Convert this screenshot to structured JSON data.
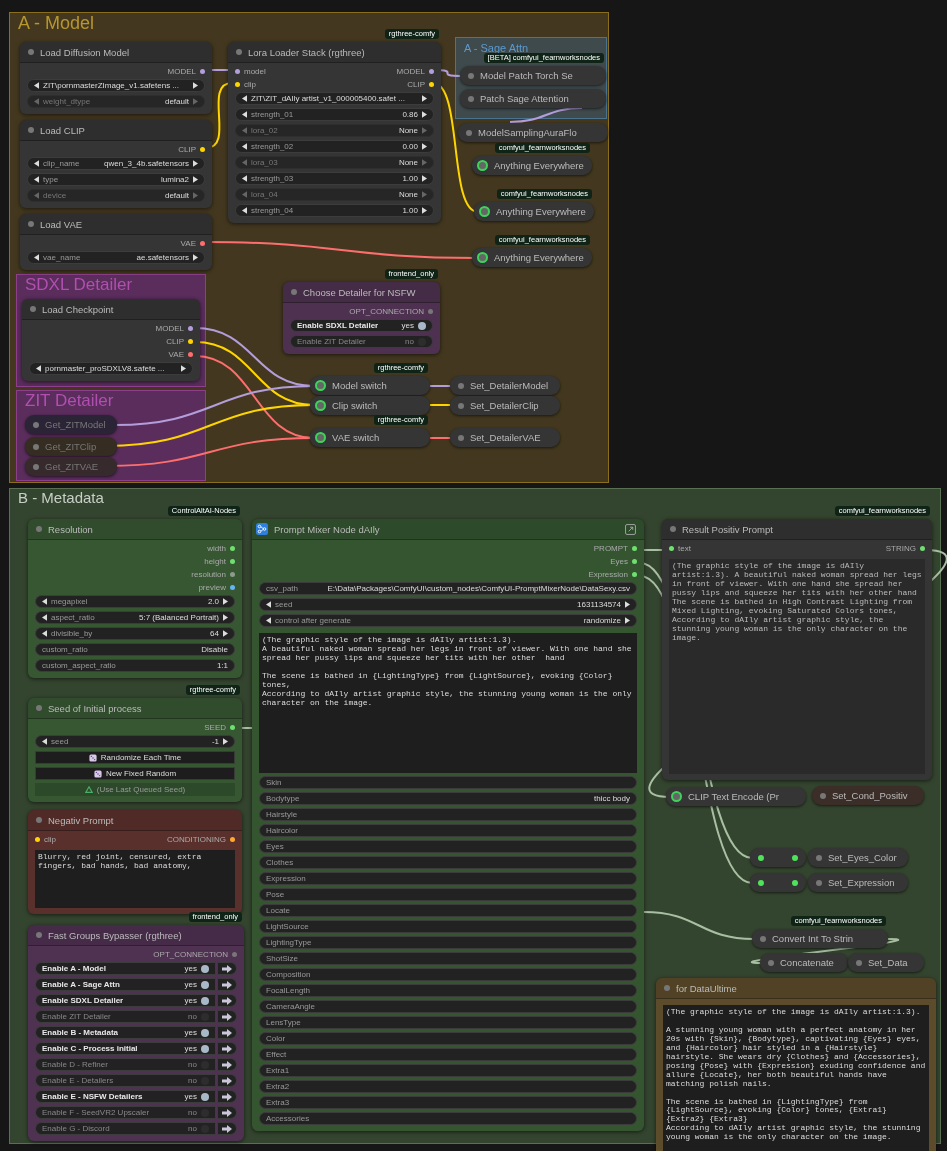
{
  "groups": [
    {
      "title": "A - Model"
    },
    {
      "title": "A - Sage Attn"
    },
    {
      "title": "SDXL Detailer"
    },
    {
      "title": "ZIT Detailer"
    },
    {
      "title": "B - Metadata"
    }
  ],
  "nodes": [
    {
      "kind": "node",
      "title": "Load Diffusion Model",
      "outputs": [
        {
          "label": "MODEL",
          "kind": "model"
        }
      ],
      "widgets": [
        {
          "kind": "combo",
          "value": "ZIT\\pornmasterZImage_v1.safetens ...",
          "disabled": false
        },
        {
          "kind": "combo",
          "label": "weight_dtype",
          "value": "default",
          "disabled": true
        }
      ]
    },
    {
      "kind": "node",
      "title": "Load CLIP",
      "outputs": [
        {
          "label": "CLIP",
          "kind": "clip"
        }
      ],
      "widgets": [
        {
          "kind": "combo",
          "label": "clip_name",
          "value": "qwen_3_4b.safetensors",
          "disabled": false
        },
        {
          "kind": "combo",
          "label": "type",
          "value": "lumina2",
          "disabled": false
        },
        {
          "kind": "combo",
          "label": "device",
          "value": "default",
          "disabled": true
        }
      ]
    },
    {
      "kind": "node",
      "title": "Load VAE",
      "outputs": [
        {
          "label": "VAE",
          "kind": "vae"
        }
      ],
      "widgets": [
        {
          "kind": "combo",
          "label": "vae_name",
          "value": "ae.safetensors",
          "disabled": false
        }
      ]
    },
    {
      "kind": "node",
      "title": "Lora Loader Stack (rgthree)",
      "badge": "rgthree-comfy",
      "inputs": [
        {
          "label": "model",
          "kind": "model"
        },
        {
          "label": "clip",
          "kind": "clip"
        }
      ],
      "outputs": [
        {
          "label": "MODEL",
          "kind": "model"
        },
        {
          "label": "CLIP",
          "kind": "clip"
        }
      ],
      "widgets": [
        {
          "kind": "combo",
          "value": "ZIT\\ZIT_dAIly artist_v1_000005400.safet ...",
          "disabled": false
        },
        {
          "kind": "combo",
          "label": "strength_01",
          "value": "0.86",
          "disabled": false
        },
        {
          "kind": "combo",
          "label": "lora_02",
          "value": "None",
          "disabled": true
        },
        {
          "kind": "combo",
          "label": "strength_02",
          "value": "0.00",
          "disabled": false
        },
        {
          "kind": "combo",
          "label": "lora_03",
          "value": "None",
          "disabled": true
        },
        {
          "kind": "combo",
          "label": "strength_03",
          "value": "1.00",
          "disabled": false
        },
        {
          "kind": "combo",
          "label": "lora_04",
          "value": "None",
          "disabled": true
        },
        {
          "kind": "combo",
          "label": "strength_04",
          "value": "1.00",
          "disabled": false
        }
      ]
    },
    {
      "kind": "collapsed",
      "title": "Model Patch Torch Se",
      "badge": "[BETA] comfyui_fearnworksnodes",
      "muted": false,
      "ring": false
    },
    {
      "kind": "collapsed",
      "title": "Patch Sage Attention",
      "muted": false,
      "ring": false
    },
    {
      "kind": "collapsed",
      "title": "ModelSamplingAuraFlo",
      "muted": false,
      "ring": false
    },
    {
      "kind": "collapsed",
      "title": "Anything Everywhere",
      "badge": "comfyui_fearnworksnodes",
      "muted": false,
      "ring": true
    },
    {
      "kind": "collapsed",
      "title": "Anything Everywhere",
      "badge": "comfyui_fearnworksnodes",
      "muted": false,
      "ring": true
    },
    {
      "kind": "collapsed",
      "title": "Anything Everywhere",
      "badge": "comfyui_fearnworksnodes",
      "muted": false,
      "ring": true
    },
    {
      "kind": "node",
      "title": "Choose Detailer for NSFW",
      "badge": "frontend_only",
      "outputs": [
        {
          "label": "OPT_CONNECTION",
          "kind": "opt"
        }
      ],
      "widgets": [
        {
          "kind": "toggle",
          "label": "Enable SDXL Detailer",
          "value": "yes",
          "on": true
        },
        {
          "kind": "toggle",
          "label": "Enable ZIT Detailer",
          "value": "no",
          "on": false
        }
      ]
    },
    {
      "kind": "node",
      "title": "Load Checkpoint",
      "outputs": [
        {
          "label": "MODEL",
          "kind": "model"
        },
        {
          "label": "CLIP",
          "kind": "clip"
        },
        {
          "label": "VAE",
          "kind": "vae"
        }
      ],
      "widgets": [
        {
          "kind": "combo",
          "value": "pornmaster_proSDXLV8.safete ...",
          "disabled": false
        }
      ]
    },
    {
      "kind": "collapsed",
      "title": "Get_ZITModel",
      "muted": true,
      "ring": false
    },
    {
      "kind": "collapsed",
      "title": "Get_ZITClip",
      "muted": true,
      "ring": false
    },
    {
      "kind": "collapsed",
      "title": "Get_ZITVAE",
      "muted": true,
      "ring": false
    },
    {
      "kind": "collapsed",
      "title": "Model switch",
      "badge": "rgthree-comfy",
      "muted": false,
      "ring": true
    },
    {
      "kind": "collapsed",
      "title": "Clip switch",
      "muted": false,
      "ring": true
    },
    {
      "kind": "collapsed",
      "title": "VAE switch",
      "badge": "rgthree-comfy",
      "muted": false,
      "ring": true
    },
    {
      "kind": "collapsed",
      "title": "Set_DetailerModel",
      "muted": false,
      "ring": false
    },
    {
      "kind": "collapsed",
      "title": "Set_DetailerClip",
      "muted": false,
      "ring": false
    },
    {
      "kind": "collapsed",
      "title": "Set_DetailerVAE",
      "muted": false,
      "ring": false
    },
    {
      "kind": "node",
      "title": "Resolution",
      "badge": "ControlAltAI-Nodes",
      "outputs": [
        {
          "label": "width",
          "kind": "int"
        },
        {
          "label": "height",
          "kind": "int"
        },
        {
          "label": "resolution",
          "kind": "float"
        },
        {
          "label": "preview",
          "kind": "image"
        }
      ],
      "widgets": [
        {
          "kind": "combo",
          "label": "megapixel",
          "value": "2.0",
          "disabled": false
        },
        {
          "kind": "combo",
          "label": "aspect_ratio",
          "value": "5:7 (Balanced Portrait)",
          "disabled": false
        },
        {
          "kind": "combo",
          "label": "divisible_by",
          "value": "64",
          "disabled": false
        },
        {
          "kind": "text",
          "label": "custom_ratio",
          "value": "Disable"
        },
        {
          "kind": "text",
          "label": "custom_aspect_ratio",
          "value": "1:1"
        }
      ]
    },
    {
      "kind": "node",
      "title": "Seed of Initial process",
      "badge": "rgthree-comfy",
      "outputs": [
        {
          "label": "SEED",
          "kind": "int"
        }
      ],
      "widgets": [
        {
          "kind": "combo",
          "label": "seed",
          "value": "-1",
          "disabled": false
        },
        {
          "kind": "dice",
          "label": "Randomize Each Time",
          "disabled": false
        },
        {
          "kind": "dice",
          "label": "New Fixed Random",
          "disabled": false
        },
        {
          "kind": "recycle",
          "label": "(Use Last Queued Seed)",
          "disabled": true
        }
      ]
    },
    {
      "kind": "node",
      "title": "Negativ Prompt",
      "inputs": [
        {
          "label": "clip",
          "kind": "clip"
        }
      ],
      "outputs": [
        {
          "label": "CONDITIONING",
          "kind": "conditioning"
        }
      ],
      "text": "Blurry, red joint, censured, extra fingers, bad hands, bad anatomy,"
    },
    {
      "kind": "node",
      "title": "Fast Groups Bypasser (rgthree)",
      "badge": "frontend_only",
      "outputs": [
        {
          "label": "OPT_CONNECTION",
          "kind": "opt"
        }
      ],
      "widgets": [
        {
          "kind": "bypass",
          "label": "Enable A - Model",
          "value": "yes",
          "on": true
        },
        {
          "kind": "bypass",
          "label": "Enable A - Sage Attn",
          "value": "yes",
          "on": true
        },
        {
          "kind": "bypass",
          "label": "Enable SDXL Detailer",
          "value": "yes",
          "on": true
        },
        {
          "kind": "bypass",
          "label": "Enable ZIT Detailer",
          "value": "no",
          "on": false
        },
        {
          "kind": "bypass",
          "label": "Enable B - Metadata",
          "value": "yes",
          "on": true
        },
        {
          "kind": "bypass",
          "label": "Enable C - Process initial",
          "value": "yes",
          "on": true
        },
        {
          "kind": "bypass",
          "label": "Enable D - Refiner",
          "value": "no",
          "on": false
        },
        {
          "kind": "bypass",
          "label": "Enable E - Detailers",
          "value": "no",
          "on": false
        },
        {
          "kind": "bypass",
          "label": "Enable E - NSFW Detailers",
          "value": "yes",
          "on": true
        },
        {
          "kind": "bypass",
          "label": "Enable F - SeedVR2 Upscaler",
          "value": "no",
          "on": false
        },
        {
          "kind": "bypass",
          "label": "Enable G - Discord",
          "value": "no",
          "on": false
        }
      ]
    },
    {
      "kind": "mixer",
      "title": "Prompt Mixer Node dAIly",
      "outputs": [
        {
          "label": "PROMPT",
          "kind": "string"
        },
        {
          "label": "Eyes",
          "kind": "string"
        },
        {
          "label": "Expression",
          "kind": "string"
        }
      ],
      "widgets": [
        {
          "kind": "text",
          "label": "csv_path",
          "value": "E:\\Data\\Packages\\ComfyUI\\custom_nodes\\ComfyUI-PromptMixerNode\\DataSexy.csv"
        },
        {
          "kind": "combo",
          "label": "seed",
          "value": "1631134574",
          "disabled": false
        },
        {
          "kind": "combo",
          "label": "control after generate",
          "value": "randomize",
          "disabled": false
        }
      ],
      "text": "(The graphic style of the image is dAIly artist:1.3).\nA beautiful naked woman spread her legs in front of viewer. With one hand she spread her pussy lips and squeeze her tits with her other  hand\n\nThe scene is bathed in {LightingType} from {LightSource}, evoking {Color} tones,\nAccording to dAIly artist graphic style, the stunning young woman is the only character on the image.",
      "fields": [
        {
          "kind": "text",
          "label": "Skin"
        },
        {
          "kind": "text",
          "label": "Bodytype",
          "value": "thicc body"
        },
        {
          "kind": "text",
          "label": "Hairstyle"
        },
        {
          "kind": "text",
          "label": "Haircolor"
        },
        {
          "kind": "text",
          "label": "Eyes"
        },
        {
          "kind": "text",
          "label": "Clothes"
        },
        {
          "kind": "text",
          "label": "Expression"
        },
        {
          "kind": "text",
          "label": "Pose"
        },
        {
          "kind": "text",
          "label": "Locate"
        },
        {
          "kind": "text",
          "label": "LightSource"
        },
        {
          "kind": "text",
          "label": "LightingType"
        },
        {
          "kind": "text",
          "label": "ShotSize"
        },
        {
          "kind": "text",
          "label": "Composition"
        },
        {
          "kind": "text",
          "label": "FocalLength"
        },
        {
          "kind": "text",
          "label": "CameraAngle"
        },
        {
          "kind": "text",
          "label": "LensType"
        },
        {
          "kind": "text",
          "label": "Color"
        },
        {
          "kind": "text",
          "label": "Effect"
        },
        {
          "kind": "text",
          "label": "Extra1"
        },
        {
          "kind": "text",
          "label": "Extra2"
        },
        {
          "kind": "text",
          "label": "Extra3"
        },
        {
          "kind": "text",
          "label": "Accessories"
        }
      ]
    },
    {
      "kind": "node",
      "title": "Result Positiv Prompt",
      "badge": "comfyui_fearnworksnodes",
      "inputs": [
        {
          "label": "text",
          "kind": "string"
        }
      ],
      "outputs": [
        {
          "label": "STRING",
          "kind": "string"
        }
      ],
      "text": "(The graphic style of the image is dAIly artist:1.3). A beautiful naked woman spread her legs in front of viewer. With one hand she spread her pussy lips and squeeze her tits with her other hand The scene is bathed in High Contrast Lighting from Mixed Lighting, evoking Saturated Colors tones, According to dAIly artist graphic style, the stunning young woman is the only character on the image."
    },
    {
      "kind": "collapsed",
      "title": "CLIP Text Encode (Pr",
      "muted": false,
      "ring": true
    },
    {
      "kind": "collapsed",
      "title": "Set_Cond_Positiv",
      "muted": false,
      "ring": false
    },
    {
      "kind": "relay"
    },
    {
      "kind": "collapsed",
      "title": "Set_Eyes_Color",
      "muted": false,
      "ring": false
    },
    {
      "kind": "relay"
    },
    {
      "kind": "collapsed",
      "title": "Set_Expression",
      "muted": false,
      "ring": false
    },
    {
      "kind": "collapsed",
      "title": "Convert Int To Strin",
      "badge": "comfyui_fearnworksnodes",
      "muted": false,
      "ring": false
    },
    {
      "kind": "collapsed",
      "title": "Concatenate",
      "muted": false,
      "ring": false
    },
    {
      "kind": "collapsed",
      "title": "Set_Data",
      "muted": false,
      "ring": false
    },
    {
      "kind": "node",
      "title": "for DataUltime",
      "text": "(The graphic style of the image is dAIly artist:1.3).\n\nA stunning young woman with a perfect anatomy in her 20s with {Skin}, {Bodytype}, captivating {Eyes} eyes, and {Haircolor} hair styled in a {Hairstyle} hairstyle. She wears dry {Clothes} and {Accessories}, posing {Pose} with {Expression} exuding confidence and allure {Locate}, her both beautiful hands have matching polish nails.\n\nThe scene is bathed in {LightingType} from {LightSource}, evoking {Color} tones, {Extra1} {Extra2} {Extra3}\nAccording to dAIly artist graphic style, the stunning young woman is the only character on the image."
    }
  ]
}
